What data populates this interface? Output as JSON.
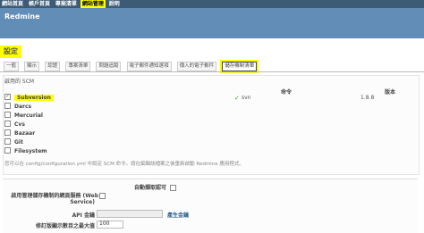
{
  "top_menu": [
    "網站首頁",
    "帳戶首頁",
    "專案清單",
    "網站管理",
    "說明"
  ],
  "site_title": "Redmine",
  "page_title": "設定",
  "tabs": [
    "一般",
    "顯示",
    "認證",
    "專案清單",
    "問題追蹤",
    "電子郵件通知選項",
    "傳入的電子郵件",
    "儲存機制清單"
  ],
  "scm": {
    "enabled_label": "啟用的 SCM",
    "col_command": "命令",
    "col_version": "版本",
    "items": [
      "Subversion",
      "Darcs",
      "Mercurial",
      "Cvs",
      "Bazaar",
      "Git",
      "Filesystem"
    ],
    "svn_command": "svn",
    "svn_version": "1.8.8",
    "note": "您可以在 config/configuration.yml 中設定 SCM 命令。請在編輯該檔案之後重新啟動 Redmine 應用程式。"
  },
  "settings": {
    "autofetch_label": "自動擷取認可",
    "ws_label_1": "啟用管理儲存機制的網頁服務 (Web",
    "ws_label_2": "Service)",
    "api_key_label": "API 金鑰",
    "generate_key": "產生金鑰",
    "max_revisions_label": "修訂版顯示數目之最大值",
    "max_revisions_value": "100"
  }
}
